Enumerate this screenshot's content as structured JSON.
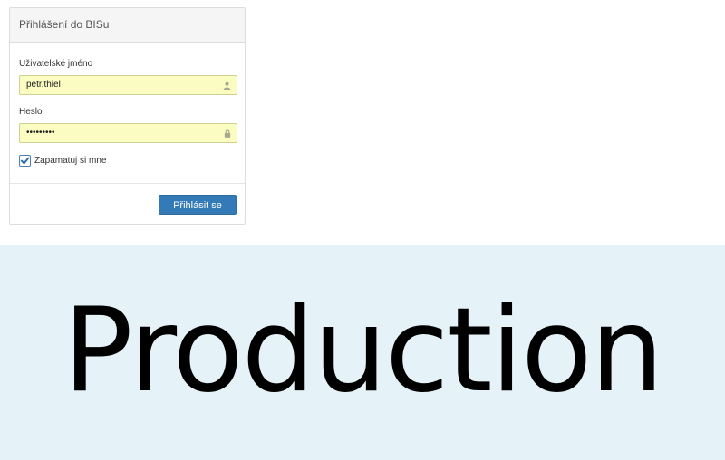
{
  "login": {
    "title": "Přihlášení do BISu",
    "username": {
      "label": "Uživatelské jméno",
      "value": "petr.thiel",
      "icon": "user-icon"
    },
    "password": {
      "label": "Heslo",
      "value": "secret123",
      "icon": "lock-icon"
    },
    "remember": {
      "label": "Zapamatuj si mne",
      "checked": true
    },
    "submit_label": "Přihlásit se"
  },
  "banner": {
    "text": "Production"
  },
  "colors": {
    "autofill_bg": "#fafcc1",
    "button_bg": "#337ab7",
    "banner_bg": "#e5f2f7"
  }
}
